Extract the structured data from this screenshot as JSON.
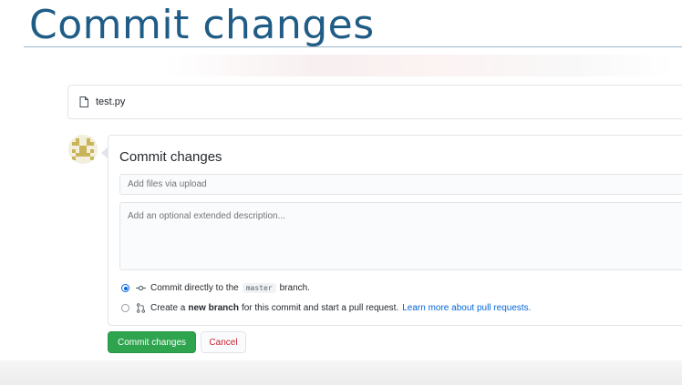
{
  "slide": {
    "title": "Commit changes"
  },
  "file": {
    "name": "test.py",
    "icon": "file-icon"
  },
  "commit": {
    "heading": "Commit changes",
    "summary_placeholder": "Add files via upload",
    "description_placeholder": "Add an optional extended description...",
    "option_direct": {
      "before": "Commit directly to the",
      "branch": "master",
      "after": "branch.",
      "selected": true
    },
    "option_new_branch": {
      "before": "Create a",
      "bold": "new branch",
      "after": "for this commit and start a pull request.",
      "link": "Learn more about pull requests.",
      "selected": false
    }
  },
  "buttons": {
    "commit": "Commit changes",
    "cancel": "Cancel"
  },
  "colors": {
    "title": "#1f5c86",
    "commit_button": "#2ea44f",
    "cancel_text": "#cb2431",
    "link": "#0366d6"
  }
}
